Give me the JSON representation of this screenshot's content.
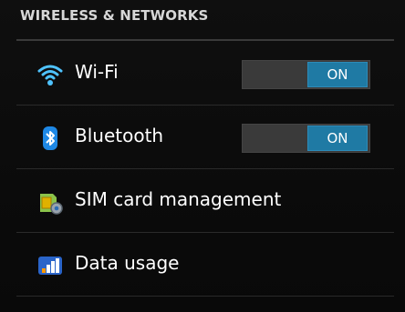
{
  "section": {
    "title": "WIRELESS & NETWORKS"
  },
  "settings": [
    {
      "label": "Wi-Fi",
      "icon": "wifi-icon",
      "toggle": "ON"
    },
    {
      "label": "Bluetooth",
      "icon": "bluetooth-icon",
      "toggle": "ON"
    },
    {
      "label": "SIM card management",
      "icon": "sim-card-settings-icon"
    },
    {
      "label": "Data usage",
      "icon": "data-usage-icon"
    }
  ],
  "colors": {
    "accent": "#1f7aa4",
    "background": "#0b0b0b",
    "divider": "#2a2a2a"
  }
}
